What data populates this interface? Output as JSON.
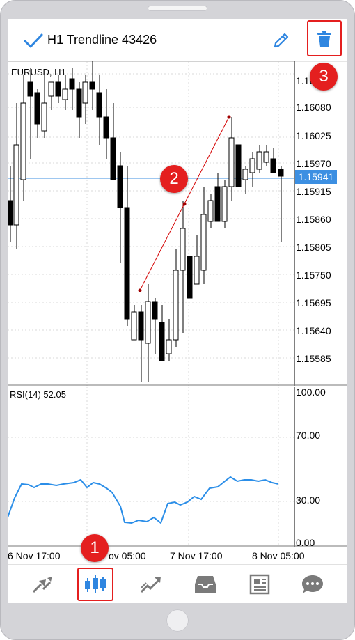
{
  "header": {
    "title": "H1 Trendline 43426"
  },
  "chart": {
    "symbol": "EURUSD, H1",
    "current_price": "1.15941",
    "price_labels": [
      "1.16",
      "1.16080",
      "1.16025",
      "1.15970",
      "1.15915",
      "1.15860",
      "1.15805",
      "1.15750",
      "1.15695",
      "1.15640",
      "1.15585"
    ],
    "rsi_title": "RSI(14) 52.05",
    "rsi_levels": [
      "100.00",
      "70.00",
      "30.00",
      "0.00"
    ],
    "time_labels": [
      "6 Nov 17:00",
      "ov 05:00",
      "7 Nov 17:00",
      "8 Nov 05:00"
    ],
    "colors": {
      "price_line": "#3c8fe2",
      "trendline": "#d40000",
      "rsi_line": "#2b8ee8",
      "badge": "#e41f1f"
    }
  },
  "annotations": {
    "badge_1": "1",
    "badge_2": "2",
    "badge_3": "3"
  },
  "toolbar": {
    "items": [
      "quotes",
      "chart",
      "trade",
      "history",
      "news",
      "chat"
    ]
  }
}
